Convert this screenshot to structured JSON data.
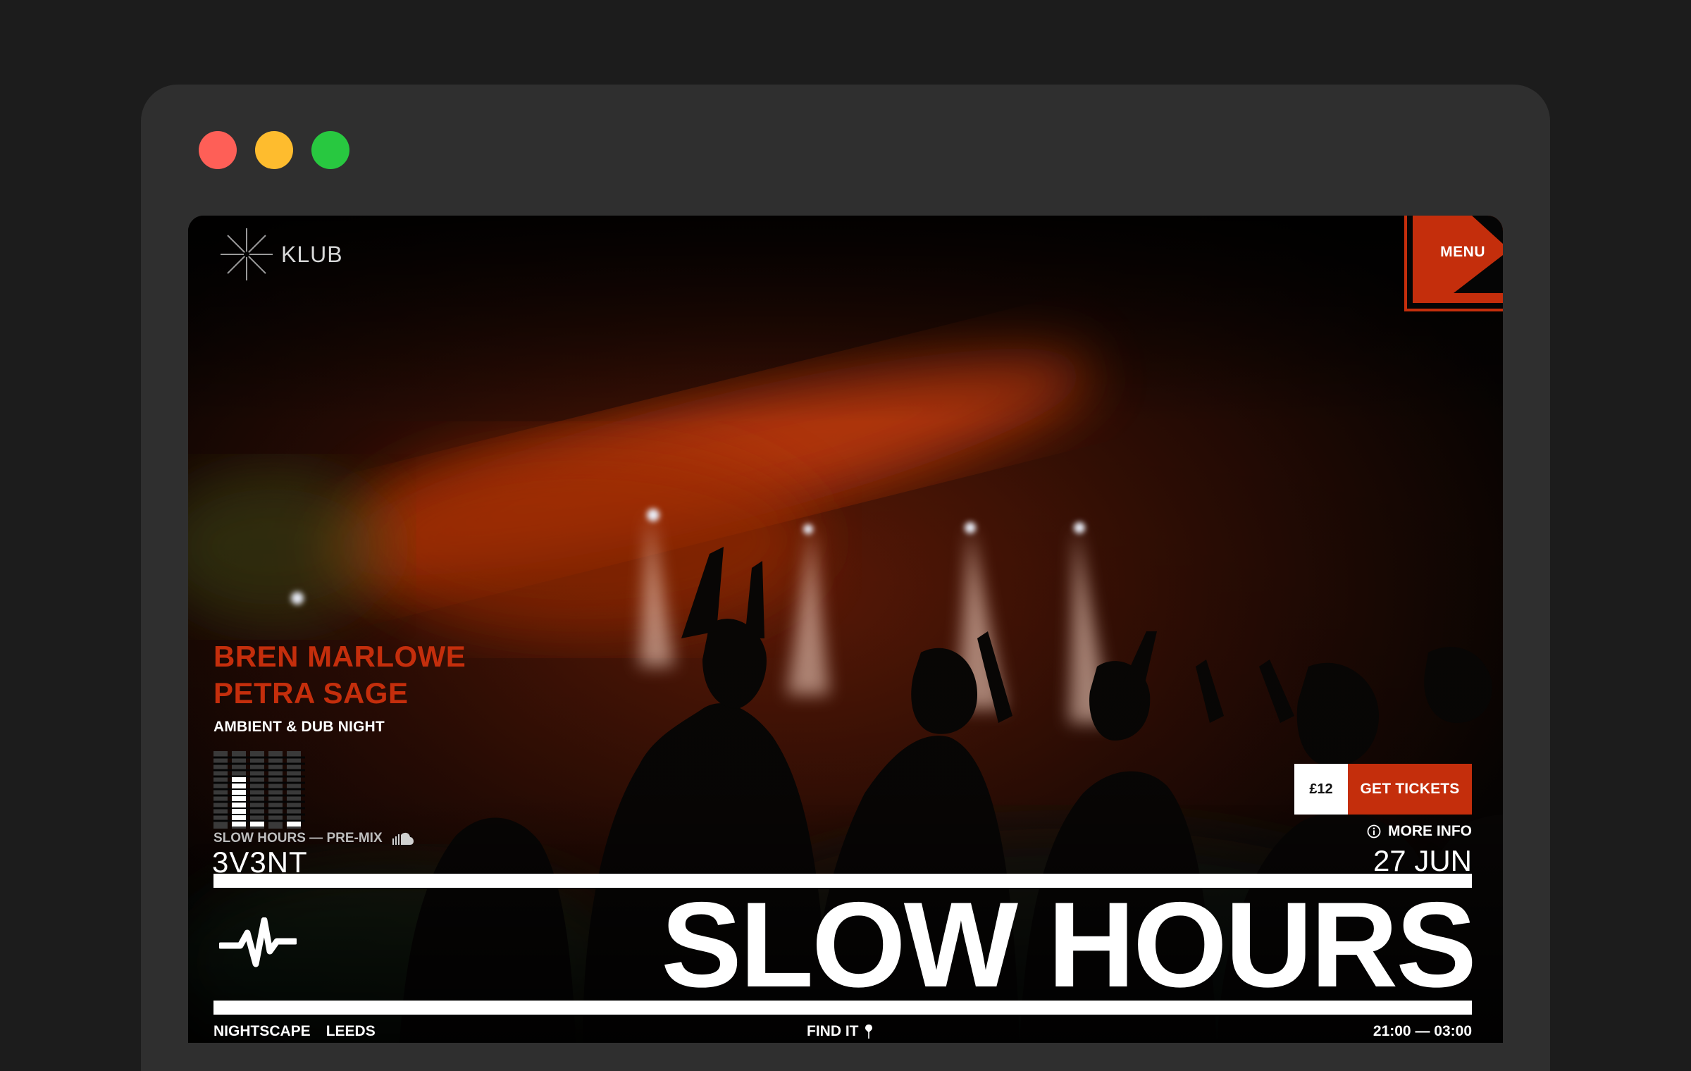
{
  "window": {
    "controls": [
      "close",
      "minimize",
      "maximize"
    ]
  },
  "header": {
    "logo_text": "KLUB",
    "menu_label": "MENU"
  },
  "event": {
    "artists": [
      "BREN MARLOWE",
      "PETRA SAGE"
    ],
    "subtitle": "AMBIENT & DUB NIGHT",
    "mix_label": "SLOW HOURS — PRE-MIX",
    "mix_icon": "soundcloud-icon",
    "brand": "3V3NT",
    "title": "SLOW HOURS",
    "price": "£12",
    "tickets_label": "GET TICKETS",
    "more_info_label": "MORE INFO",
    "date": "27 JUN",
    "venue": "NIGHTSCAPE",
    "city": "LEEDS",
    "find_label": "FIND IT",
    "time": "21:00 — 03:00"
  },
  "colors": {
    "accent": "#c42e0c",
    "text": "#ffffff",
    "frame": "#2f2f2f",
    "backdrop": "#1c1c1c"
  }
}
